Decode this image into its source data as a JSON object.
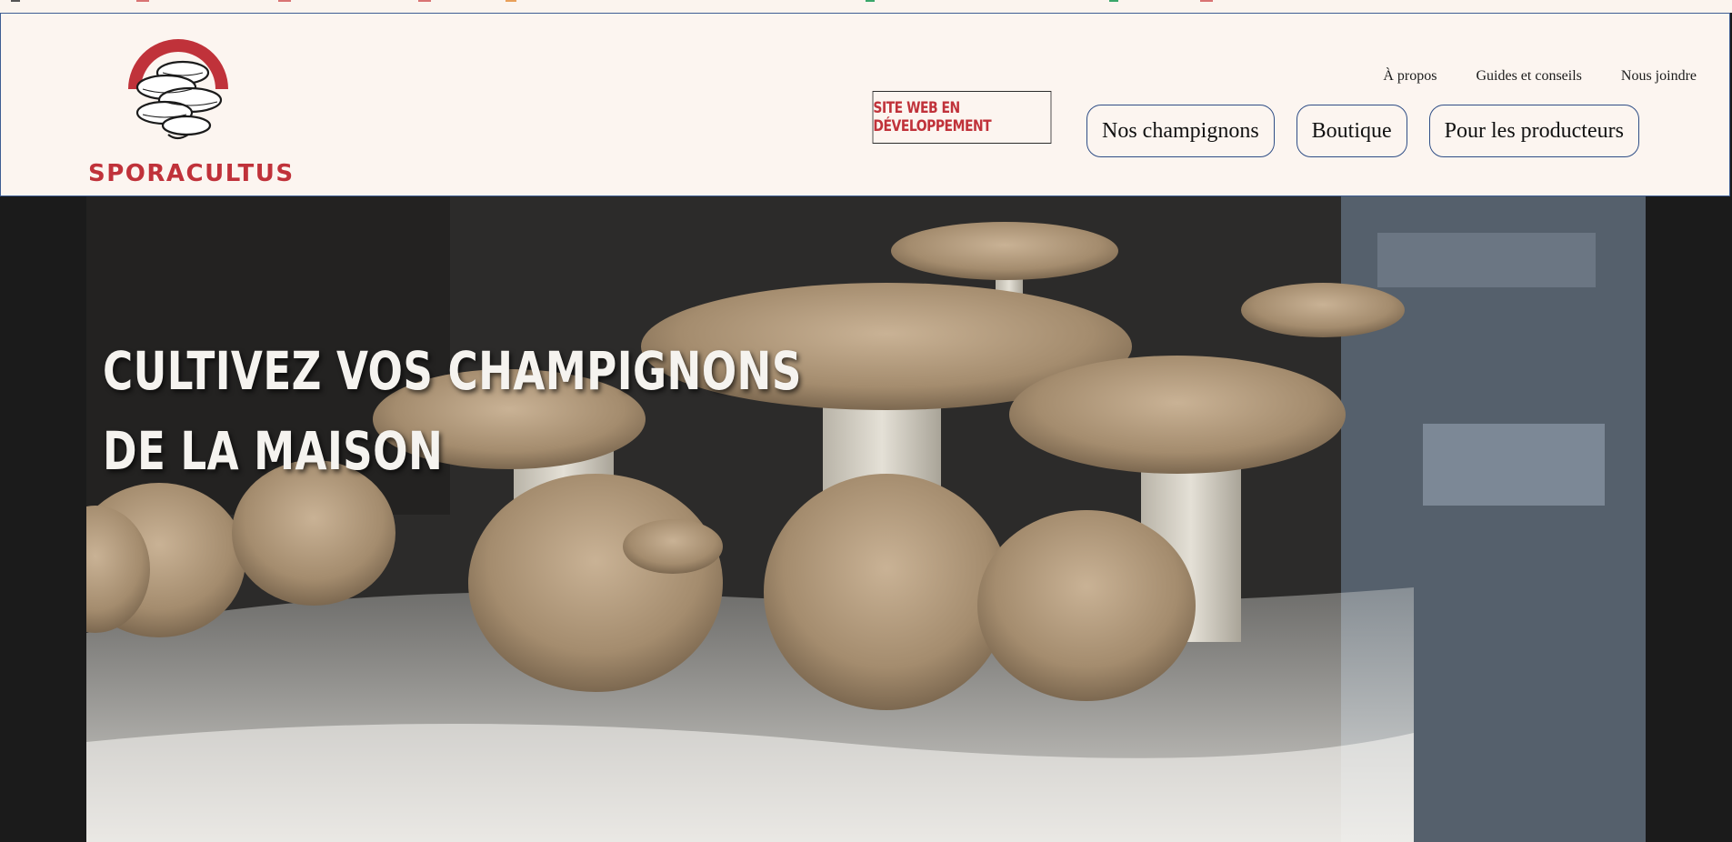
{
  "brand": {
    "name": "SPORACULTUS",
    "accent_color": "#c0323a",
    "border_color": "#2f4e86"
  },
  "header": {
    "utility_nav": [
      "À propos",
      "Guides et conseils",
      "Nous joindre"
    ],
    "dev_notice": "SITE WEB EN DÉVELOPPEMENT",
    "main_nav": [
      "Nos champignons",
      "Boutique",
      "Pour les producteurs"
    ]
  },
  "hero": {
    "title_line1": "CULTIVEZ VOS CHAMPIGNONS",
    "title_line2": "DE LA MAISON",
    "image": "mushroom-cluster-photo"
  }
}
